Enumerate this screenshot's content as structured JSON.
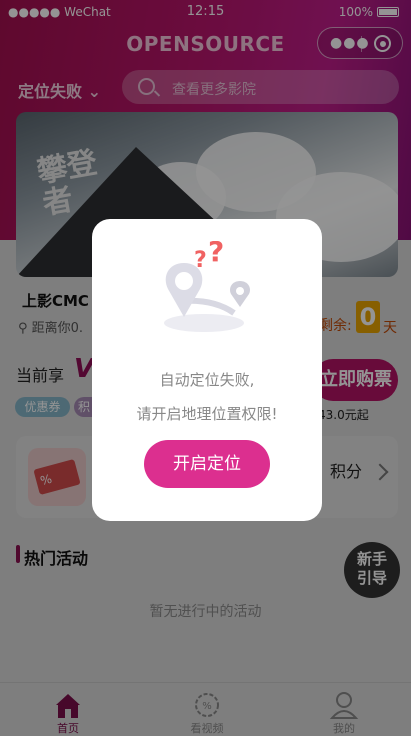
{
  "status_bar": {
    "carrier": "●●●●● WeChat",
    "time": "12:15",
    "battery": "100%"
  },
  "header": {
    "title": "OPENSOURCE",
    "location": "定位失败",
    "search_placeholder": "查看更多影院"
  },
  "cinema": {
    "name": "上影CMC",
    "distance": "距离你0.",
    "remaining_label": "剩余:",
    "remaining_days": "0",
    "days_unit": "天"
  },
  "membership": {
    "enjoy_prefix": "当前享",
    "buy_button": "立即购票",
    "tag_coupon": "优惠券",
    "tag_points": "积",
    "price": "43.0元起"
  },
  "points_card": {
    "label": "积分"
  },
  "activities": {
    "title": "热门活动",
    "empty": "暂无进行中的活动",
    "guide": "新手引导",
    "guide_line1": "新手",
    "guide_line2": "引导"
  },
  "tabs": [
    {
      "label": "首页",
      "icon": "home-icon",
      "active": true
    },
    {
      "label": "看视频",
      "icon": "video-icon",
      "active": false
    },
    {
      "label": "我的",
      "icon": "profile-icon",
      "active": false
    }
  ],
  "dialog": {
    "line1": "自动定位失败,",
    "line2": "请开启地理位置权限!",
    "button": "开启定位",
    "accent": "#dc2f8f"
  },
  "colors": {
    "brand": "#b31465",
    "header_gradient_start": "#a3104f",
    "header_gradient_end": "#c01d8a"
  }
}
